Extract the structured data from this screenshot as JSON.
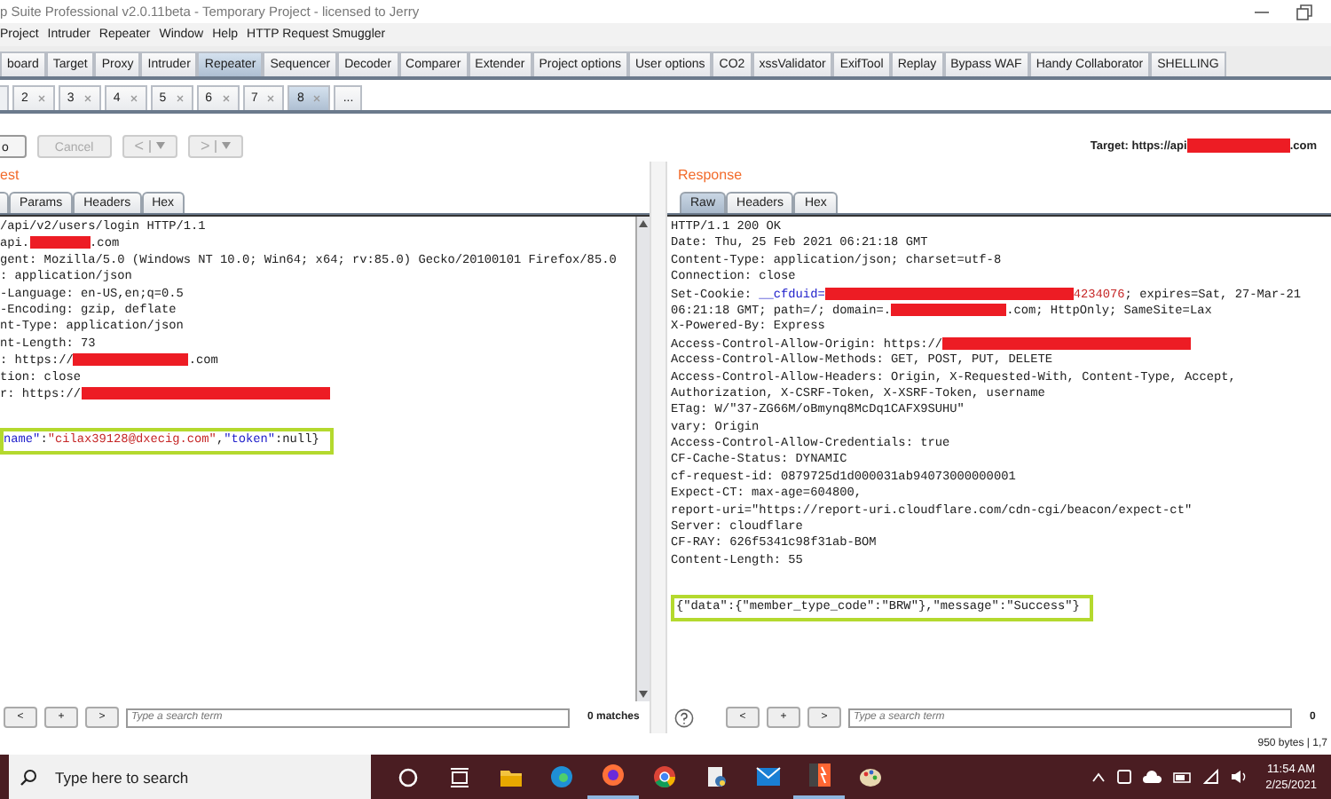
{
  "window": {
    "title": "p Suite Professional v2.0.11beta - Temporary Project - licensed to Jerry"
  },
  "menu": [
    "Project",
    "Intruder",
    "Repeater",
    "Window",
    "Help",
    "HTTP Request Smuggler"
  ],
  "tool_tabs": [
    {
      "label": "board",
      "selected": false
    },
    {
      "label": "Target",
      "selected": false
    },
    {
      "label": "Proxy",
      "selected": false
    },
    {
      "label": "Intruder",
      "selected": false
    },
    {
      "label": "Repeater",
      "selected": true
    },
    {
      "label": "Sequencer",
      "selected": false
    },
    {
      "label": "Decoder",
      "selected": false
    },
    {
      "label": "Comparer",
      "selected": false
    },
    {
      "label": "Extender",
      "selected": false
    },
    {
      "label": "Project options",
      "selected": false
    },
    {
      "label": "User options",
      "selected": false
    },
    {
      "label": "CO2",
      "selected": false
    },
    {
      "label": "xssValidator",
      "selected": false
    },
    {
      "label": "ExifTool",
      "selected": false
    },
    {
      "label": "Replay",
      "selected": false
    },
    {
      "label": "Bypass WAF",
      "selected": false
    },
    {
      "label": "Handy Collaborator",
      "selected": false
    },
    {
      "label": "SHELLING",
      "selected": false
    }
  ],
  "repeater_tabs": [
    {
      "label": "2",
      "selected": false
    },
    {
      "label": "3",
      "selected": false
    },
    {
      "label": "4",
      "selected": false
    },
    {
      "label": "5",
      "selected": false
    },
    {
      "label": "6",
      "selected": false
    },
    {
      "label": "7",
      "selected": false
    },
    {
      "label": "8",
      "selected": true
    }
  ],
  "more_tab": "...",
  "toolbar": [
    {
      "kind": "plain",
      "label": "o",
      "disabled": false
    },
    {
      "kind": "plain",
      "label": "Cancel",
      "disabled": true
    },
    {
      "kind": "dropdown",
      "label": "<",
      "disabled": true
    },
    {
      "kind": "dropdown",
      "label": ">",
      "disabled": true
    }
  ],
  "target": {
    "prefix": "Target: https://api",
    "suffix": ".com"
  },
  "request": {
    "title": "est",
    "tabs": [
      {
        "label": "Params",
        "selected": false
      },
      {
        "label": "Headers",
        "selected": false
      },
      {
        "label": "Hex",
        "selected": false
      }
    ],
    "lines": [
      {
        "kind": "text",
        "segments": [
          {
            "kind": "plain",
            "text": "/api/v2/users/login HTTP/1.1"
          }
        ]
      },
      {
        "kind": "text",
        "segments": [
          {
            "kind": "plain",
            "text": "api."
          },
          {
            "kind": "redacted-short"
          },
          {
            "kind": "plain",
            "text": ".com"
          }
        ]
      },
      {
        "kind": "text",
        "segments": [
          {
            "kind": "plain",
            "text": "gent: Mozilla/5.0 (Windows NT 10.0; Win64; x64; rv:85.0) Gecko/20100101 Firefox/85.0"
          }
        ]
      },
      {
        "kind": "text",
        "segments": [
          {
            "kind": "plain",
            "text": ": application/json"
          }
        ]
      },
      {
        "kind": "text",
        "segments": [
          {
            "kind": "plain",
            "text": "-Language: en-US,en;q=0.5"
          }
        ]
      },
      {
        "kind": "text",
        "segments": [
          {
            "kind": "plain",
            "text": "-Encoding: gzip, deflate"
          }
        ]
      },
      {
        "kind": "text",
        "segments": [
          {
            "kind": "plain",
            "text": "nt-Type: application/json"
          }
        ]
      },
      {
        "kind": "text",
        "segments": [
          {
            "kind": "plain",
            "text": "nt-Length: 73"
          }
        ]
      },
      {
        "kind": "text",
        "segments": [
          {
            "kind": "plain",
            "text": ": https://"
          },
          {
            "kind": "redacted-medium"
          },
          {
            "kind": "plain",
            "text": ".com"
          }
        ]
      },
      {
        "kind": "text",
        "segments": [
          {
            "kind": "plain",
            "text": "tion: close"
          }
        ]
      },
      {
        "kind": "text",
        "segments": [
          {
            "kind": "plain",
            "text": "r: https://"
          },
          {
            "kind": "redacted-long"
          }
        ]
      },
      {
        "kind": "blank"
      },
      {
        "kind": "highlight",
        "segments": [
          {
            "kind": "key",
            "text": "name\""
          },
          {
            "kind": "plain",
            "text": ":"
          },
          {
            "kind": "value",
            "text": "\"cilax39128@dxecig.com\""
          },
          {
            "kind": "plain",
            "text": ","
          },
          {
            "kind": "key",
            "text": "\"token\""
          },
          {
            "kind": "plain",
            "text": ":null}"
          }
        ]
      }
    ]
  },
  "response": {
    "title": "Response",
    "tabs": [
      {
        "label": "Raw",
        "selected": true
      },
      {
        "label": "Headers",
        "selected": false
      },
      {
        "label": "Hex",
        "selected": false
      }
    ],
    "lines": [
      {
        "kind": "text",
        "segments": [
          {
            "kind": "plain",
            "text": "HTTP/1.1 200 OK"
          }
        ]
      },
      {
        "kind": "text",
        "segments": [
          {
            "kind": "plain",
            "text": "Date: Thu, 25 Feb 2021 06:21:18 GMT"
          }
        ]
      },
      {
        "kind": "text",
        "segments": [
          {
            "kind": "plain",
            "text": "Content-Type: application/json; charset=utf-8"
          }
        ]
      },
      {
        "kind": "text",
        "segments": [
          {
            "kind": "plain",
            "text": "Connection: close"
          }
        ]
      },
      {
        "kind": "text",
        "segments": [
          {
            "kind": "plain",
            "text": "Set-Cookie: "
          },
          {
            "kind": "key",
            "text": "__cfduid="
          },
          {
            "kind": "redacted-long"
          },
          {
            "kind": "value",
            "text": "4234076"
          },
          {
            "kind": "plain",
            "text": "; expires=Sat, 27-Mar-21"
          }
        ]
      },
      {
        "kind": "text",
        "segments": [
          {
            "kind": "plain",
            "text": "06:21:18 GMT; path=/; domain=."
          },
          {
            "kind": "redacted-medium"
          },
          {
            "kind": "plain",
            "text": ".com; HttpOnly; SameSite=Lax"
          }
        ]
      },
      {
        "kind": "text",
        "segments": [
          {
            "kind": "plain",
            "text": "X-Powered-By: Express"
          }
        ]
      },
      {
        "kind": "text",
        "segments": [
          {
            "kind": "plain",
            "text": "Access-Control-Allow-Origin: https://"
          },
          {
            "kind": "redacted-long"
          }
        ]
      },
      {
        "kind": "text",
        "segments": [
          {
            "kind": "plain",
            "text": "Access-Control-Allow-Methods: GET, POST, PUT, DELETE"
          }
        ]
      },
      {
        "kind": "text",
        "segments": [
          {
            "kind": "plain",
            "text": "Access-Control-Allow-Headers: Origin, X-Requested-With, Content-Type, Accept,"
          }
        ]
      },
      {
        "kind": "text",
        "segments": [
          {
            "kind": "plain",
            "text": "Authorization, X-CSRF-Token, X-XSRF-Token, username"
          }
        ]
      },
      {
        "kind": "text",
        "segments": [
          {
            "kind": "plain",
            "text": "ETag: W/\"37-ZG66M/oBmynq8McDq1CAFX9SUHU\""
          }
        ]
      },
      {
        "kind": "text",
        "segments": [
          {
            "kind": "plain",
            "text": "vary: Origin"
          }
        ]
      },
      {
        "kind": "text",
        "segments": [
          {
            "kind": "plain",
            "text": "Access-Control-Allow-Credentials: true"
          }
        ]
      },
      {
        "kind": "text",
        "segments": [
          {
            "kind": "plain",
            "text": "CF-Cache-Status: DYNAMIC"
          }
        ]
      },
      {
        "kind": "text",
        "segments": [
          {
            "kind": "plain",
            "text": "cf-request-id: 0879725d1d000031ab94073000000001"
          }
        ]
      },
      {
        "kind": "text",
        "segments": [
          {
            "kind": "plain",
            "text": "Expect-CT: max-age=604800,"
          }
        ]
      },
      {
        "kind": "text",
        "segments": [
          {
            "kind": "plain",
            "text": "report-uri=\"https://report-uri.cloudflare.com/cdn-cgi/beacon/expect-ct\""
          }
        ]
      },
      {
        "kind": "text",
        "segments": [
          {
            "kind": "plain",
            "text": "Server: cloudflare"
          }
        ]
      },
      {
        "kind": "text",
        "segments": [
          {
            "kind": "plain",
            "text": "CF-RAY: 626f5341c98f31ab-BOM"
          }
        ]
      },
      {
        "kind": "text",
        "segments": [
          {
            "kind": "plain",
            "text": "Content-Length: 55"
          }
        ]
      },
      {
        "kind": "blank"
      },
      {
        "kind": "highlight",
        "segments": [
          {
            "kind": "plain",
            "text": "{\"data\":{\"member_type_code\":\"BRW\"},\"message\":\"Success\"}"
          }
        ]
      }
    ]
  },
  "search_bars": [
    {
      "prev": "<",
      "add": "+",
      "next": ">",
      "placeholder": "Type a search term",
      "matches": "0 matches"
    },
    {
      "prev": "<",
      "add": "+",
      "next": ">",
      "placeholder": "Type a search term",
      "matches": "0"
    }
  ],
  "status_bar": "950 bytes | 1,7",
  "taskbar": {
    "search_placeholder": "Type here to search",
    "apps": [
      {
        "kind": "cortana",
        "running": false
      },
      {
        "kind": "taskview",
        "running": false
      },
      {
        "kind": "folder",
        "running": false
      },
      {
        "kind": "edge",
        "running": false
      },
      {
        "kind": "firefox",
        "running": true
      },
      {
        "kind": "chrome",
        "running": false
      },
      {
        "kind": "python",
        "running": false
      },
      {
        "kind": "mail",
        "running": false
      },
      {
        "kind": "burp",
        "running": true
      },
      {
        "kind": "paint",
        "running": false
      }
    ],
    "time": "11:54 AM",
    "date": "2/25/2021"
  }
}
